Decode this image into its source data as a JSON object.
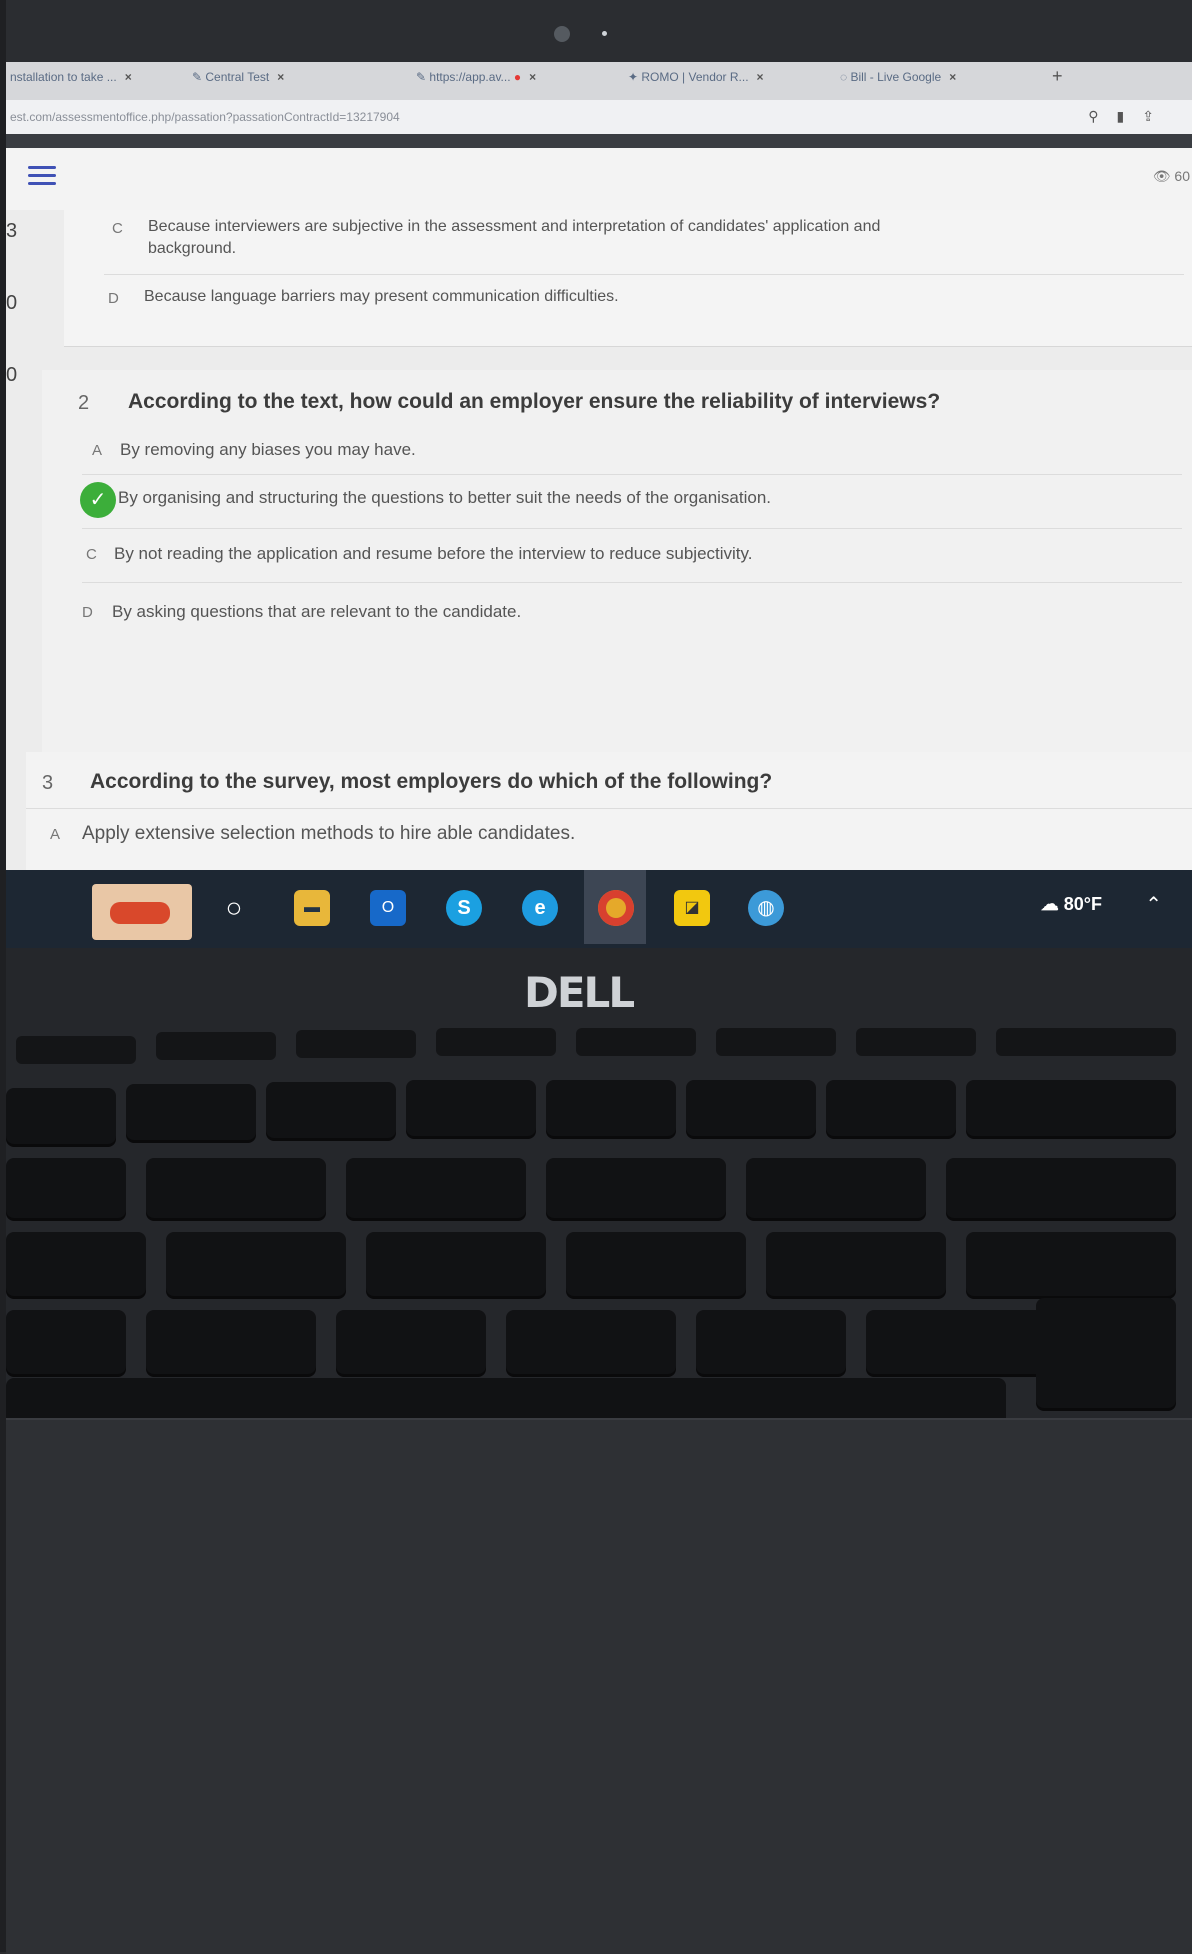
{
  "browser": {
    "tabs": [
      {
        "label": "nstallation to take ..."
      },
      {
        "label": "Central Test"
      },
      {
        "label": "https://app.av..."
      },
      {
        "label": "ROMO | Vendor R..."
      },
      {
        "label": "Bill - Live Google"
      }
    ],
    "url": "est.com/assessmentoffice.php/passation?passationContractId=13217904"
  },
  "app": {
    "views": "60"
  },
  "left_nav": [
    "3",
    "0",
    "0"
  ],
  "question_1_partial": {
    "options": [
      {
        "letter": "C",
        "text_line1": "Because interviewers are subjective in the assessment and interpretation of candidates' application and",
        "text_line2": "background."
      },
      {
        "letter": "D",
        "text": "Because language barriers may present communication difficulties."
      }
    ]
  },
  "question_2": {
    "number": "2",
    "text": "According to the text, how could an employer ensure the reliability of interviews?",
    "options": [
      {
        "letter": "A",
        "text": "By removing any biases you may have."
      },
      {
        "letter": "B",
        "text": "By organising and structuring the questions to better suit the needs of the organisation.",
        "selected": true
      },
      {
        "letter": "C",
        "text": "By not reading the application and resume before the interview to reduce subjectivity."
      },
      {
        "letter": "D",
        "text": "By asking questions that are relevant to the candidate."
      }
    ]
  },
  "question_3": {
    "number": "3",
    "text": "According to the survey, most employers do which of the following?",
    "options": [
      {
        "letter": "A",
        "text": "Apply extensive selection methods to hire able candidates."
      }
    ]
  },
  "taskbar": {
    "weather": "80°F",
    "icons": [
      "search-icon",
      "file-explorer-icon",
      "outlook-icon",
      "skype-icon",
      "edge-icon",
      "chrome-icon",
      "sticky-notes-icon",
      "globe-icon"
    ]
  },
  "laptop": {
    "brand": "DELL"
  }
}
